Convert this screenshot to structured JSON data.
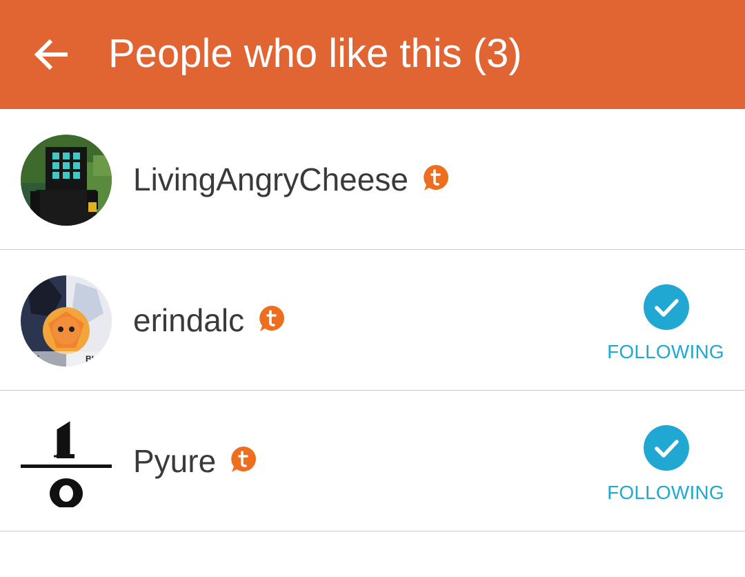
{
  "header": {
    "title": "People who like this (3)",
    "back_icon": "arrow-left-icon",
    "background_color": "#e06532"
  },
  "users": [
    {
      "name": "LivingAngryCheese",
      "badge_icon": "tumblr-chat-icon",
      "avatar": "minecraft-character-avatar",
      "following": false
    },
    {
      "name": "erindalc",
      "badge_icon": "tumblr-chat-icon",
      "avatar": "anime-artwork-avatar",
      "following": true,
      "follow_label": "FOLLOWING"
    },
    {
      "name": "Pyure",
      "badge_icon": "tumblr-chat-icon",
      "avatar": "one-over-zero-avatar",
      "following": true,
      "follow_label": "FOLLOWING"
    }
  ],
  "colors": {
    "accent_orange": "#ee6e1f",
    "following_blue": "#21a8d2",
    "text_dark": "#3a3a3a",
    "divider": "#c8c8c8"
  }
}
